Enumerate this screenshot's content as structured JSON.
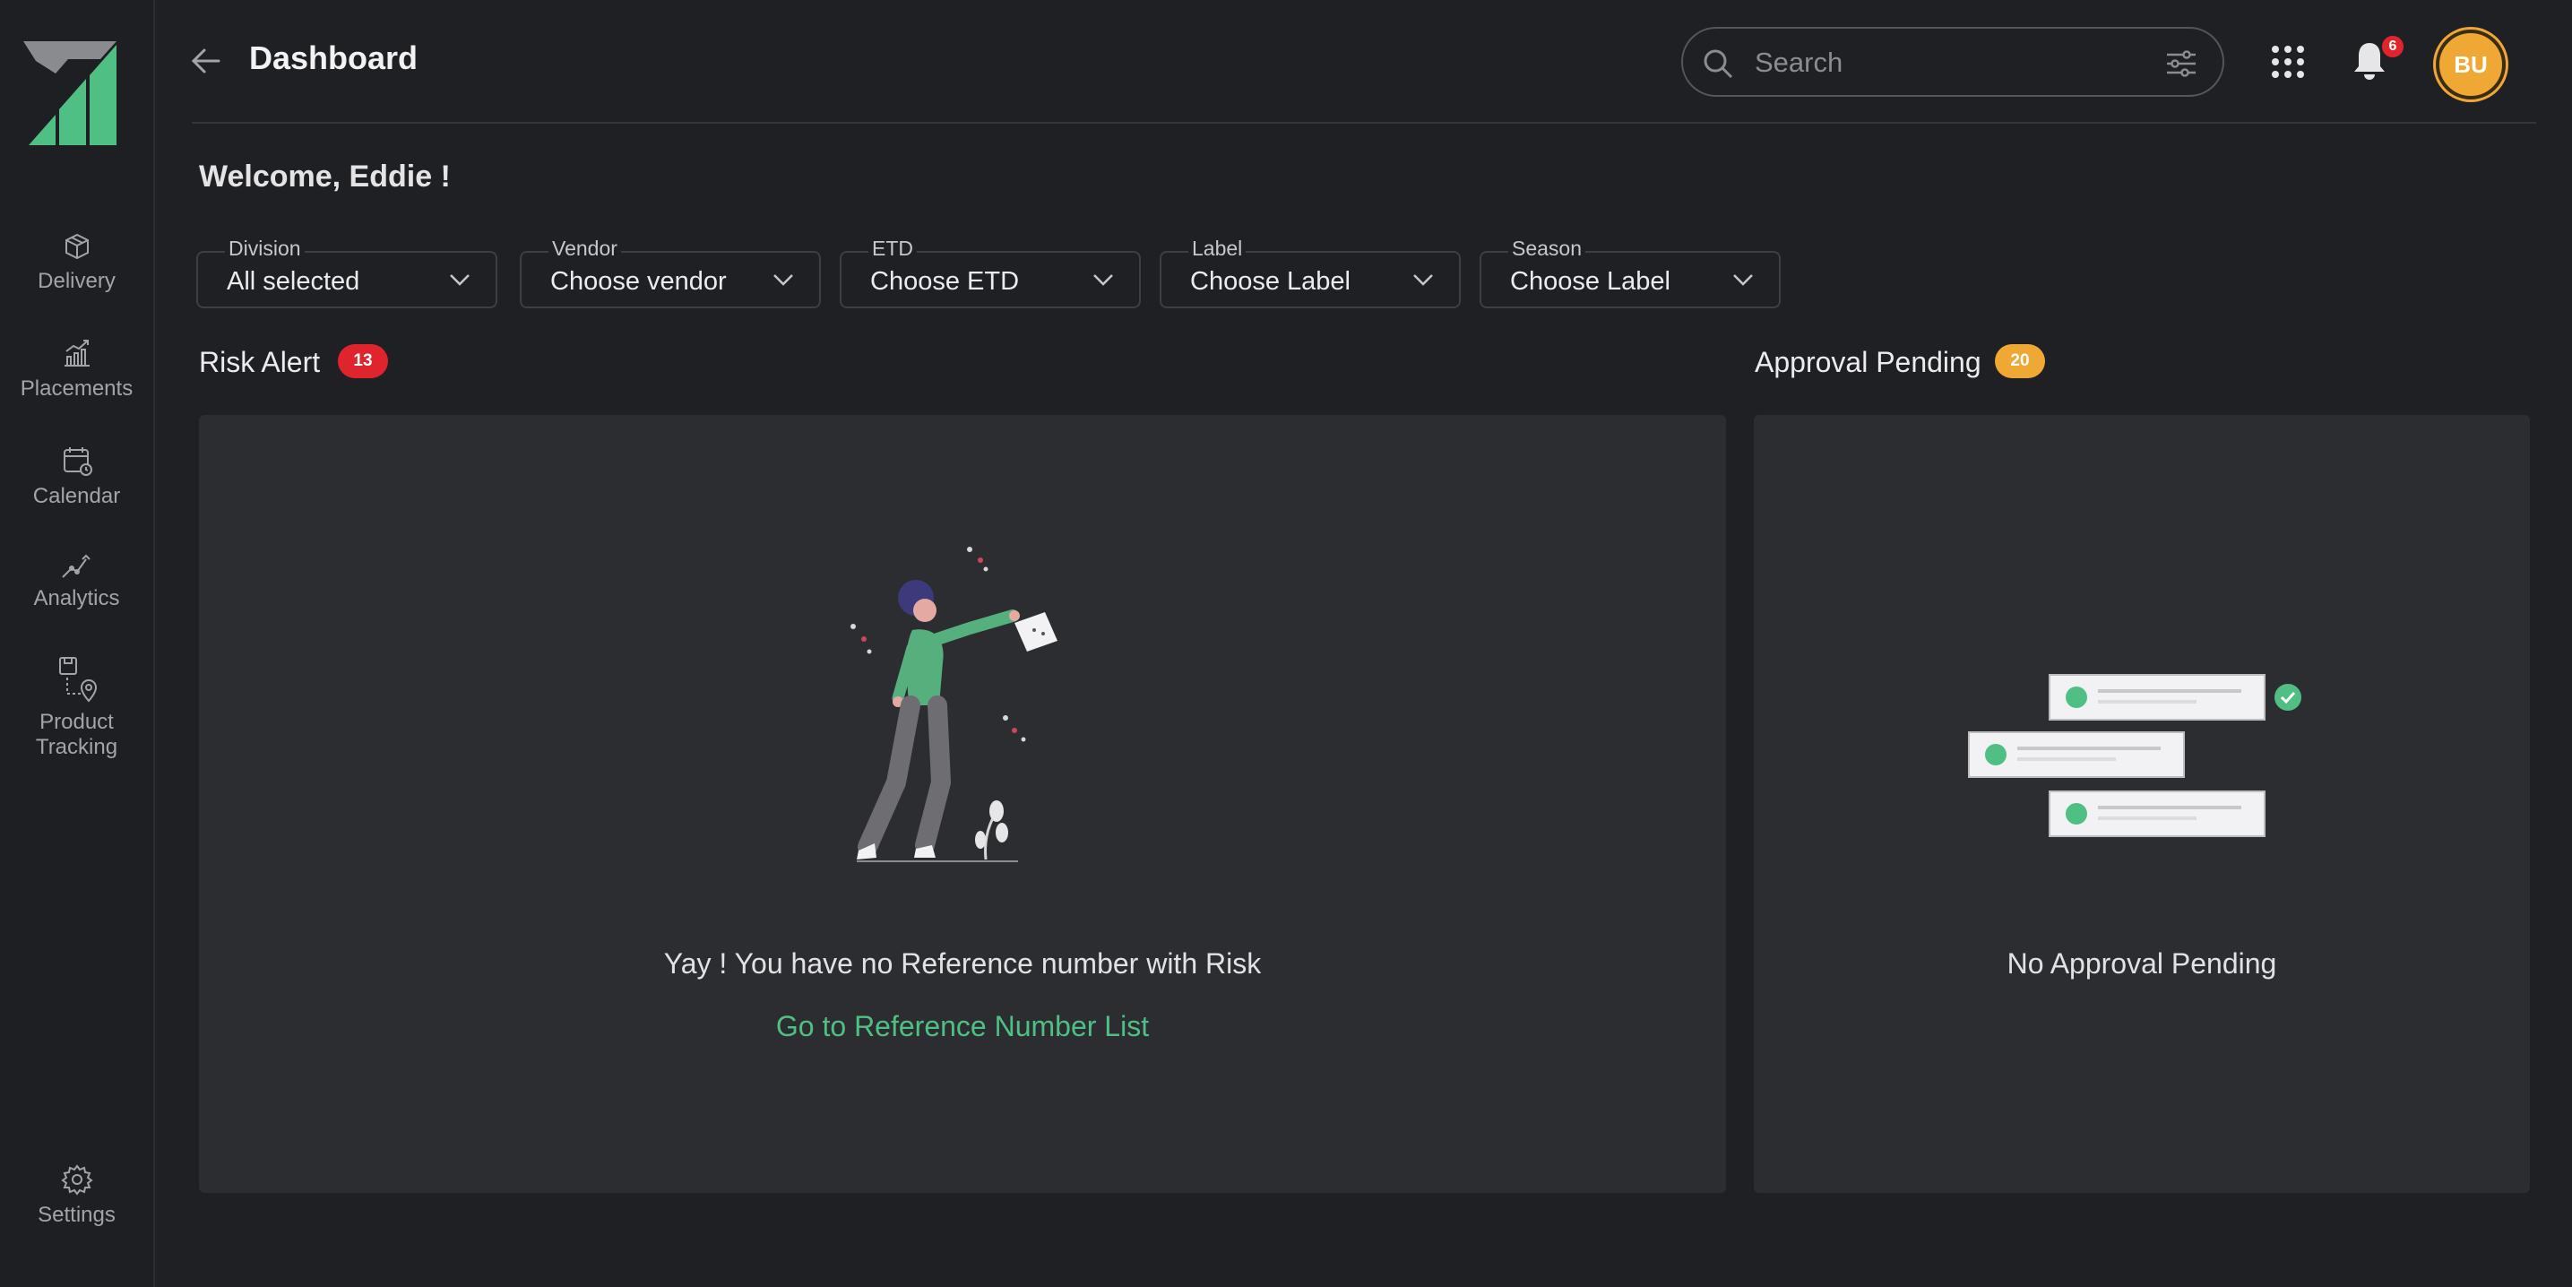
{
  "header": {
    "title": "Dashboard"
  },
  "search": {
    "placeholder": "Search"
  },
  "notifications": {
    "count": "6"
  },
  "user": {
    "initials": "BU"
  },
  "sidebar": {
    "items": [
      {
        "label": "Delivery"
      },
      {
        "label": "Placements"
      },
      {
        "label": "Calendar"
      },
      {
        "label": "Analytics"
      },
      {
        "label_line1": "Product",
        "label_line2": "Tracking"
      }
    ],
    "settings_label": "Settings"
  },
  "welcome": "Welcome, Eddie  !",
  "filters": [
    {
      "label": "Division",
      "value": "All selected"
    },
    {
      "label": "Vendor",
      "value": "Choose vendor"
    },
    {
      "label": "ETD",
      "value": "Choose ETD"
    },
    {
      "label": "Label",
      "value": "Choose Label"
    },
    {
      "label": "Season",
      "value": "Choose Label"
    }
  ],
  "risk_alert": {
    "title": "Risk Alert",
    "count": "13",
    "badge_color": "#e0242e",
    "message": "Yay ! You have no Reference number with Risk",
    "link": "Go to Reference Number List"
  },
  "approval": {
    "title": "Approval Pending",
    "count": "20",
    "badge_color": "#efa833",
    "message": "No Approval Pending"
  },
  "colors": {
    "accent": "#4fbf83",
    "background": "#1f2024",
    "panel": "#2c2d31"
  }
}
